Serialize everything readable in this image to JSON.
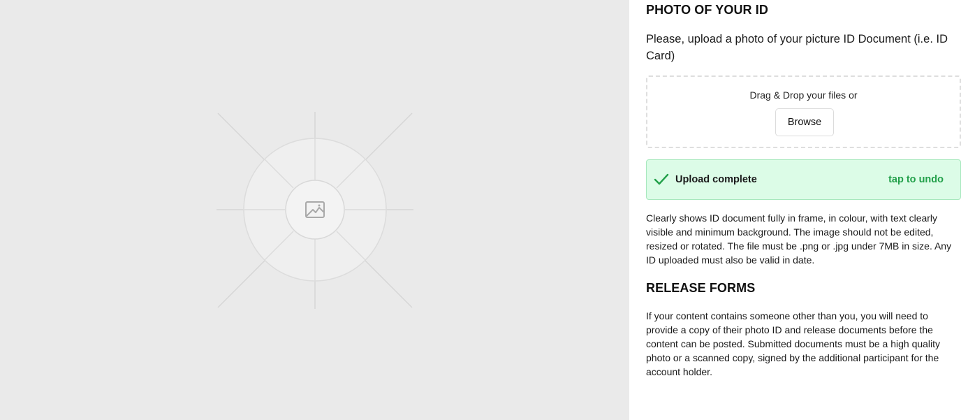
{
  "preview": {
    "icon": "image-icon"
  },
  "photo_id": {
    "title": "PHOTO OF YOUR ID",
    "subtitle": "Please, upload a photo of your picture ID Document (i.e. ID Card)",
    "dropzone_text": "Drag & Drop your files or",
    "browse_label": "Browse",
    "status": {
      "label": "Upload complete",
      "undo_label": "tap to undo",
      "icon": "check-icon",
      "accent_color": "#22a04a",
      "background_color": "#dcfce7"
    },
    "description": "Clearly shows ID document fully in frame, in colour, with text clearly visible and minimum background. The image should not be edited, resized or rotated. The file must be .png or .jpg under 7MB in size. Any ID uploaded must also be valid in date."
  },
  "release_forms": {
    "title": "RELEASE FORMS",
    "text": "If your content contains someone other than you, you will need to provide a copy of their photo ID and release documents before the content can be posted. Submitted documents must be a high quality photo or a scanned copy, signed by the additional participant for the account holder."
  }
}
